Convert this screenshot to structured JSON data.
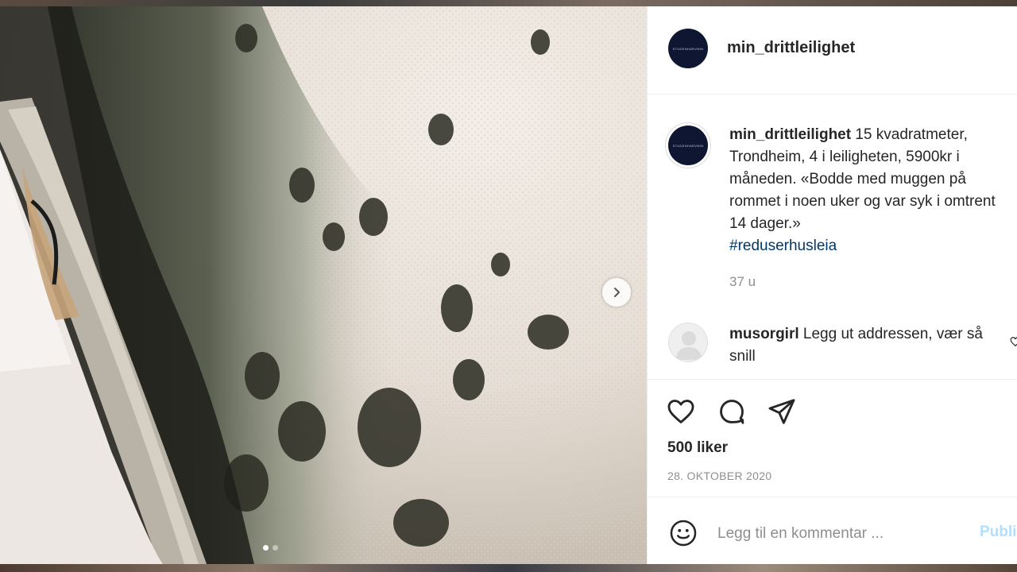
{
  "post": {
    "username": "min_drittleilighet",
    "avatar_text": "STUDENHARVMIN"
  },
  "caption": {
    "username": "min_drittleilighet",
    "text": " 15 kvadratmeter, Trondheim, 4 i leiligheten, 5900kr i måneden. «Bodde med muggen på rommet i noen uker og var syk i omtrent 14 dager.»",
    "hashtag": "#reduserhusleia",
    "time_ago": "37 u"
  },
  "comment": {
    "username": "musorgirl",
    "text": " Legg ut addressen, vær så snill"
  },
  "actions": {
    "likes": "500 liker",
    "date": "28. OKTOBER 2020"
  },
  "comment_box": {
    "placeholder": "Legg til en kommentar ...",
    "publish_label": "Publiser"
  },
  "carousel": {
    "slide_count": 2,
    "active_index": 0
  },
  "icons": {
    "next": "chevron-right-icon",
    "like": "heart-icon",
    "comment": "comment-bubble-icon",
    "share": "paper-plane-icon",
    "emoji": "smiley-icon",
    "comment_like": "small-heart-icon"
  },
  "colors": {
    "hashtag": "#00376b",
    "publish_disabled": "#b2dffc",
    "muted_text": "#8e8e8e",
    "avatar_bg": "#0f1631"
  }
}
